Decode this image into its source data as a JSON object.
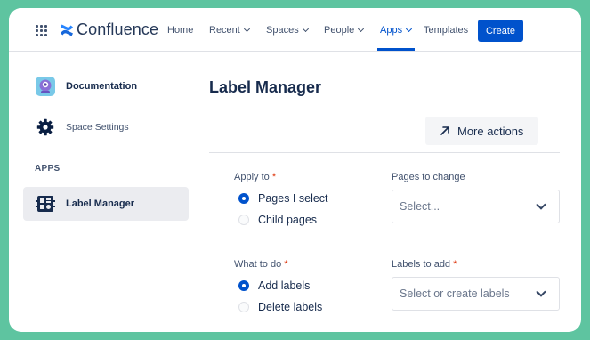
{
  "nav": {
    "logo_text": "Confluence",
    "items": [
      {
        "label": "Home",
        "dropdown": false
      },
      {
        "label": "Recent",
        "dropdown": true
      },
      {
        "label": "Spaces",
        "dropdown": true
      },
      {
        "label": "People",
        "dropdown": true
      },
      {
        "label": "Apps",
        "dropdown": true,
        "active": true
      },
      {
        "label": "Templates",
        "dropdown": false
      }
    ],
    "create_label": "Create"
  },
  "sidebar": {
    "documentation_label": "Documentation",
    "space_settings_label": "Space Settings",
    "apps_heading": "APPS",
    "label_manager_label": "Label Manager"
  },
  "main": {
    "title": "Label Manager",
    "more_actions_label": "More actions",
    "apply_to": {
      "label": "Apply to",
      "required_mark": "*",
      "options": [
        {
          "label": "Pages I select",
          "selected": true
        },
        {
          "label": "Child pages",
          "selected": false
        }
      ]
    },
    "pages_to_change": {
      "label": "Pages to change",
      "placeholder": "Select..."
    },
    "what_to_do": {
      "label": "What to do",
      "required_mark": "*",
      "options": [
        {
          "label": "Add labels",
          "selected": true
        },
        {
          "label": "Delete labels",
          "selected": false
        }
      ]
    },
    "labels_to_add": {
      "label": "Labels to add",
      "required_mark": "*",
      "placeholder": "Select or create labels"
    }
  },
  "colors": {
    "accent": "#0052cc",
    "frame_background": "#5ec4a0",
    "required": "#de350b"
  }
}
